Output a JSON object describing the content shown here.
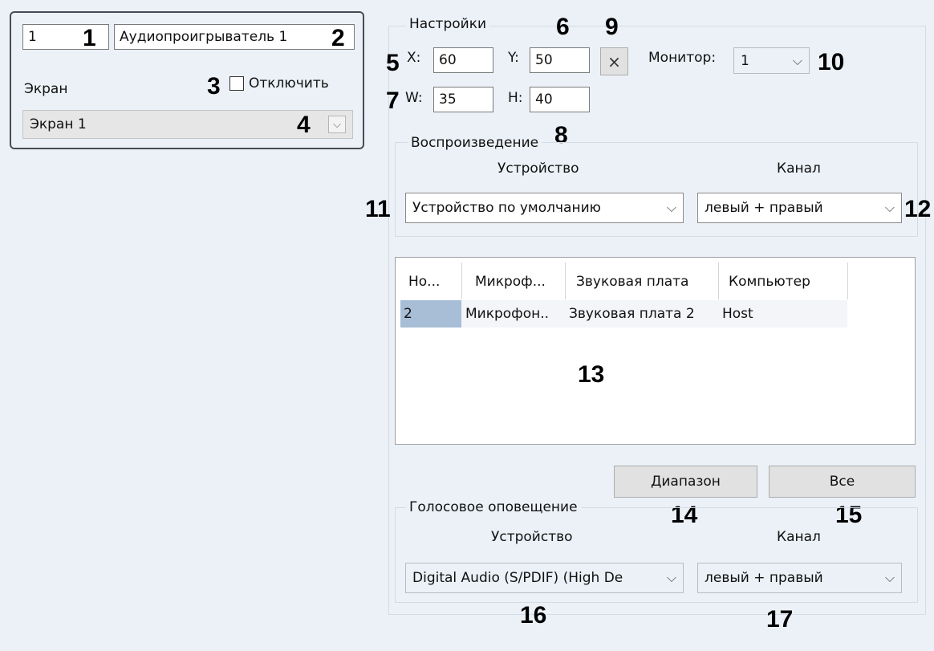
{
  "object_panel": {
    "id_value": "1",
    "name_value": "Аудиопроигрыватель 1",
    "screen_label": "Экран",
    "disable_label": "Отключить",
    "screen_select_value": "Экран 1"
  },
  "settings": {
    "title": "Настройки",
    "x_label": "X:",
    "x_value": "60",
    "y_label": "Y:",
    "y_value": "50",
    "w_label": "W:",
    "w_value": "35",
    "h_label": "H:",
    "h_value": "40",
    "reset_label": "×",
    "monitor_label": "Монитор:",
    "monitor_value": "1"
  },
  "playback": {
    "title": "Воспроизведение",
    "device_label": "Устройство",
    "channel_label": "Канал",
    "device_value": "Устройство по умолчанию",
    "channel_value": "левый + правый"
  },
  "mic_table": {
    "columns": [
      "Но...",
      "Микроф...",
      "Звуковая плата",
      "Компьютер"
    ],
    "rows": [
      [
        "2",
        "Микрофон..",
        "Звуковая плата 2",
        "Host"
      ]
    ]
  },
  "buttons": {
    "range": "Диапазон",
    "all": "Все"
  },
  "voice": {
    "title": "Голосовое оповещение",
    "device_label": "Устройство",
    "channel_label": "Канал",
    "device_value": "Digital Audio (S/PDIF) (High De",
    "channel_value": "левый + правый"
  },
  "callouts": [
    "1",
    "2",
    "3",
    "4",
    "5",
    "6",
    "7",
    "8",
    "9",
    "10",
    "11",
    "12",
    "13",
    "14",
    "15",
    "16",
    "17"
  ]
}
